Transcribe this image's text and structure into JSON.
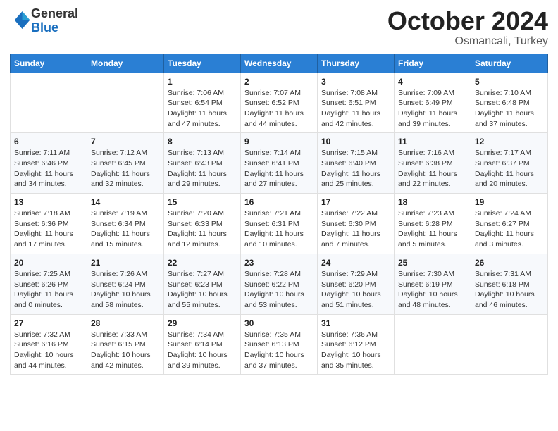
{
  "header": {
    "logo_line1": "General",
    "logo_line2": "Blue",
    "month": "October 2024",
    "location": "Osmancali, Turkey"
  },
  "days_of_week": [
    "Sunday",
    "Monday",
    "Tuesday",
    "Wednesday",
    "Thursday",
    "Friday",
    "Saturday"
  ],
  "weeks": [
    [
      {
        "day": "",
        "info": ""
      },
      {
        "day": "",
        "info": ""
      },
      {
        "day": "1",
        "info": "Sunrise: 7:06 AM\nSunset: 6:54 PM\nDaylight: 11 hours and 47 minutes."
      },
      {
        "day": "2",
        "info": "Sunrise: 7:07 AM\nSunset: 6:52 PM\nDaylight: 11 hours and 44 minutes."
      },
      {
        "day": "3",
        "info": "Sunrise: 7:08 AM\nSunset: 6:51 PM\nDaylight: 11 hours and 42 minutes."
      },
      {
        "day": "4",
        "info": "Sunrise: 7:09 AM\nSunset: 6:49 PM\nDaylight: 11 hours and 39 minutes."
      },
      {
        "day": "5",
        "info": "Sunrise: 7:10 AM\nSunset: 6:48 PM\nDaylight: 11 hours and 37 minutes."
      }
    ],
    [
      {
        "day": "6",
        "info": "Sunrise: 7:11 AM\nSunset: 6:46 PM\nDaylight: 11 hours and 34 minutes."
      },
      {
        "day": "7",
        "info": "Sunrise: 7:12 AM\nSunset: 6:45 PM\nDaylight: 11 hours and 32 minutes."
      },
      {
        "day": "8",
        "info": "Sunrise: 7:13 AM\nSunset: 6:43 PM\nDaylight: 11 hours and 29 minutes."
      },
      {
        "day": "9",
        "info": "Sunrise: 7:14 AM\nSunset: 6:41 PM\nDaylight: 11 hours and 27 minutes."
      },
      {
        "day": "10",
        "info": "Sunrise: 7:15 AM\nSunset: 6:40 PM\nDaylight: 11 hours and 25 minutes."
      },
      {
        "day": "11",
        "info": "Sunrise: 7:16 AM\nSunset: 6:38 PM\nDaylight: 11 hours and 22 minutes."
      },
      {
        "day": "12",
        "info": "Sunrise: 7:17 AM\nSunset: 6:37 PM\nDaylight: 11 hours and 20 minutes."
      }
    ],
    [
      {
        "day": "13",
        "info": "Sunrise: 7:18 AM\nSunset: 6:36 PM\nDaylight: 11 hours and 17 minutes."
      },
      {
        "day": "14",
        "info": "Sunrise: 7:19 AM\nSunset: 6:34 PM\nDaylight: 11 hours and 15 minutes."
      },
      {
        "day": "15",
        "info": "Sunrise: 7:20 AM\nSunset: 6:33 PM\nDaylight: 11 hours and 12 minutes."
      },
      {
        "day": "16",
        "info": "Sunrise: 7:21 AM\nSunset: 6:31 PM\nDaylight: 11 hours and 10 minutes."
      },
      {
        "day": "17",
        "info": "Sunrise: 7:22 AM\nSunset: 6:30 PM\nDaylight: 11 hours and 7 minutes."
      },
      {
        "day": "18",
        "info": "Sunrise: 7:23 AM\nSunset: 6:28 PM\nDaylight: 11 hours and 5 minutes."
      },
      {
        "day": "19",
        "info": "Sunrise: 7:24 AM\nSunset: 6:27 PM\nDaylight: 11 hours and 3 minutes."
      }
    ],
    [
      {
        "day": "20",
        "info": "Sunrise: 7:25 AM\nSunset: 6:26 PM\nDaylight: 11 hours and 0 minutes."
      },
      {
        "day": "21",
        "info": "Sunrise: 7:26 AM\nSunset: 6:24 PM\nDaylight: 10 hours and 58 minutes."
      },
      {
        "day": "22",
        "info": "Sunrise: 7:27 AM\nSunset: 6:23 PM\nDaylight: 10 hours and 55 minutes."
      },
      {
        "day": "23",
        "info": "Sunrise: 7:28 AM\nSunset: 6:22 PM\nDaylight: 10 hours and 53 minutes."
      },
      {
        "day": "24",
        "info": "Sunrise: 7:29 AM\nSunset: 6:20 PM\nDaylight: 10 hours and 51 minutes."
      },
      {
        "day": "25",
        "info": "Sunrise: 7:30 AM\nSunset: 6:19 PM\nDaylight: 10 hours and 48 minutes."
      },
      {
        "day": "26",
        "info": "Sunrise: 7:31 AM\nSunset: 6:18 PM\nDaylight: 10 hours and 46 minutes."
      }
    ],
    [
      {
        "day": "27",
        "info": "Sunrise: 7:32 AM\nSunset: 6:16 PM\nDaylight: 10 hours and 44 minutes."
      },
      {
        "day": "28",
        "info": "Sunrise: 7:33 AM\nSunset: 6:15 PM\nDaylight: 10 hours and 42 minutes."
      },
      {
        "day": "29",
        "info": "Sunrise: 7:34 AM\nSunset: 6:14 PM\nDaylight: 10 hours and 39 minutes."
      },
      {
        "day": "30",
        "info": "Sunrise: 7:35 AM\nSunset: 6:13 PM\nDaylight: 10 hours and 37 minutes."
      },
      {
        "day": "31",
        "info": "Sunrise: 7:36 AM\nSunset: 6:12 PM\nDaylight: 10 hours and 35 minutes."
      },
      {
        "day": "",
        "info": ""
      },
      {
        "day": "",
        "info": ""
      }
    ]
  ]
}
